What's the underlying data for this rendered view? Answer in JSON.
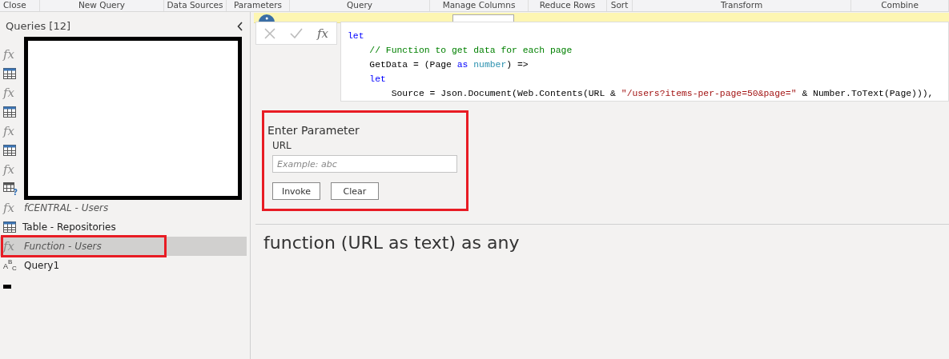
{
  "ribbon_groups": [
    {
      "label": "Close"
    },
    {
      "label": "New Query"
    },
    {
      "label": "Data Sources"
    },
    {
      "label": "Parameters"
    },
    {
      "label": "Query"
    },
    {
      "label": "Manage Columns"
    },
    {
      "label": "Reduce Rows"
    },
    {
      "label": "Sort"
    },
    {
      "label": "Transform"
    },
    {
      "label": "Combine"
    }
  ],
  "queries_pane": {
    "title": "Queries [12]",
    "items": [
      {
        "kind": "function",
        "icon_text": "fx",
        "selected": false
      },
      {
        "kind": "table",
        "selected": false
      },
      {
        "kind": "function",
        "icon_text": "fx",
        "selected": false
      },
      {
        "kind": "table",
        "selected": false
      },
      {
        "kind": "function",
        "icon_text": "fx",
        "selected": false
      },
      {
        "kind": "table",
        "selected": false
      },
      {
        "kind": "function",
        "icon_text": "fx",
        "selected": false
      },
      {
        "kind": "table-error",
        "icon_text": "?",
        "selected": false
      },
      {
        "kind": "function",
        "icon_text": "fx",
        "label": "fCENTRAL - Users",
        "selected": false,
        "highlighted": false
      },
      {
        "kind": "table",
        "label": "Table - Repositories",
        "selected": false,
        "highlighted": false
      },
      {
        "kind": "function",
        "icon_text": "fx",
        "label": "Function - Users",
        "selected": true,
        "highlighted": true
      },
      {
        "kind": "text",
        "icon_text": "ABC",
        "label": "Query1",
        "selected": false,
        "highlighted": false
      }
    ]
  },
  "formula_bar": {
    "fx_label": "fx",
    "code_lines": [
      [
        {
          "kind": "keyword",
          "text": "let"
        }
      ],
      [
        {
          "kind": "comment",
          "text": "    // Function to get data for each page"
        }
      ],
      [
        {
          "kind": "plain",
          "text": "    GetData = (Page "
        },
        {
          "kind": "keyword",
          "text": "as"
        },
        {
          "kind": "type",
          "text": " number"
        },
        {
          "kind": "plain",
          "text": ") =>"
        }
      ],
      [
        {
          "kind": "keyword",
          "text": "    let"
        }
      ],
      [
        {
          "kind": "plain",
          "text": "        Source = Json.Document(Web.Contents(URL & "
        },
        {
          "kind": "string",
          "text": "\"/users?items-per-page=50&page=\""
        },
        {
          "kind": "plain",
          "text": " & Number.ToText(Page))),"
        }
      ]
    ]
  },
  "parameter_panel": {
    "title": "Enter Parameter",
    "highlighted": true,
    "field_label": "URL",
    "placeholder": "Example: abc",
    "buttons": [
      "Invoke",
      "Clear"
    ]
  },
  "signature": "function (URL as text) as any"
}
